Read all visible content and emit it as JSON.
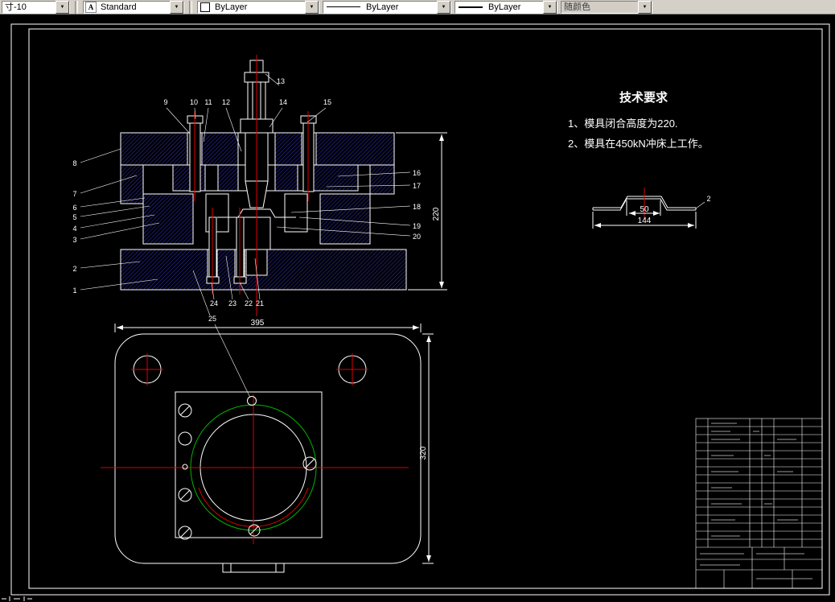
{
  "colors": {
    "canvas_bg": "#000000",
    "line": "#ffffff",
    "centerline": "#dd0000",
    "aux_green": "#00b400",
    "hatch": "#2a2aa0",
    "toolbar_bg": "#d4d0c8"
  },
  "toolbar": {
    "dim_style": "寸-10",
    "text_style": "Standard",
    "color": "ByLayer",
    "linetype": "ByLayer",
    "lineweight": "ByLayer",
    "plot_style": "随颜色",
    "dropdown_arrow": "▼"
  },
  "drawing": {
    "tech_requirements": {
      "title": "技术要求",
      "item1": "1、模具闭合高度为220.",
      "item2": "2、模具在450kN冲床上工作。"
    },
    "section_view": {
      "labels_top": [
        "9",
        "10",
        "11",
        "12",
        "13",
        "14",
        "15"
      ],
      "labels_left": [
        "8",
        "7",
        "6",
        "5",
        "4",
        "3",
        "2",
        "1"
      ],
      "labels_right": [
        "16",
        "17",
        "18",
        "19",
        "20"
      ],
      "labels_bottom": [
        "24",
        "23",
        "22",
        "21"
      ],
      "dim_height": "220"
    },
    "plan_view": {
      "label": "25",
      "dim_width": "395",
      "dim_height": "320"
    },
    "part_profile": {
      "dim_top": "50",
      "dim_width": "144",
      "dim_thickness": "2"
    }
  }
}
